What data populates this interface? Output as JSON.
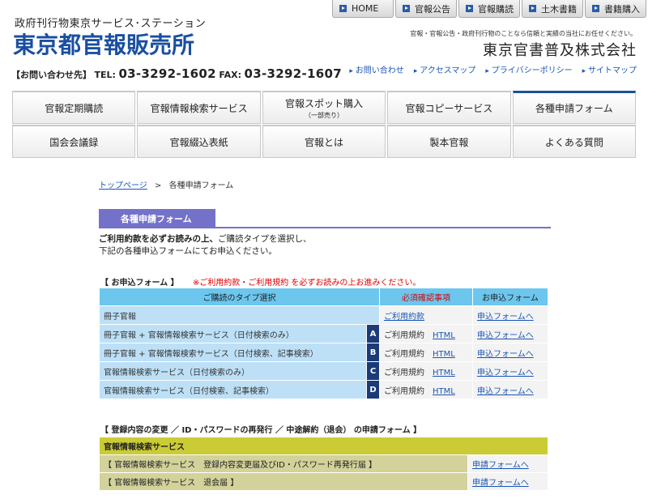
{
  "header": {
    "subtitle": "政府刊行物東京サービス･ステーション",
    "logo": "東京都官報販売所",
    "contact_label": "【お問い合わせ先】",
    "tel_label": "TEL:",
    "tel": "03-3292-1602",
    "fax_label": "FAX:",
    "fax": "03-3292-1607",
    "tagline": "官報・官報公告・政府刊行物のことなら信頼と実績の当社にお任せください。",
    "company": "東京官書普及株式会社",
    "top_nav": [
      "HOME",
      "官報公告",
      "官報購読",
      "土木書籍",
      "書籍購入"
    ],
    "util_links": [
      "お問い合わせ",
      "アクセスマップ",
      "プライバシーポリシー",
      "サイトマップ"
    ]
  },
  "nav": {
    "row1": [
      {
        "label": "官報定期購読",
        "sub": ""
      },
      {
        "label": "官報情報検索サービス",
        "sub": ""
      },
      {
        "label": "官報スポット購入",
        "sub": "（一部売り）"
      },
      {
        "label": "官報コピーサービス",
        "sub": ""
      },
      {
        "label": "各種申請フォーム",
        "sub": ""
      }
    ],
    "row2": [
      "国会会議録",
      "官報綴込表紙",
      "官報とは",
      "製本官報",
      "よくある質問"
    ],
    "active": "各種申請フォーム"
  },
  "breadcrumb": {
    "home": "トップページ",
    "sep": ">",
    "current": "各種申請フォーム"
  },
  "section": {
    "title": "各種申請フォーム",
    "intro_bold": "ご利用約款を必ずお読みの上、",
    "intro_rest": "ご購読タイプを選択し、",
    "intro_line2": "下記の各種申込フォームにてお申込ください。"
  },
  "apply_form": {
    "heading": "【 お申込フォーム 】",
    "warning": "※ご利用約款・ご利用規約 を必ずお読みの上お進みください。",
    "columns": [
      "ご購読のタイプ選択",
      "必須確認事項",
      "お申込フォーム"
    ],
    "rows": [
      {
        "type": "冊子官報",
        "letter": "",
        "conf": "ご利用約款",
        "html": "",
        "link": "申込フォームへ"
      },
      {
        "type": "冊子官報 + 官報情報検索サービス（日付検索のみ）",
        "letter": "A",
        "conf": "ご利用規約",
        "html": "HTML",
        "link": "申込フォームへ"
      },
      {
        "type": "冊子官報 + 官報情報検索サービス（日付検索、記事検索）",
        "letter": "B",
        "conf": "ご利用規約",
        "html": "HTML",
        "link": "申込フォームへ"
      },
      {
        "type": "官報情報検索サービス（日付検索のみ）",
        "letter": "C",
        "conf": "ご利用規約",
        "html": "HTML",
        "link": "申込フォームへ"
      },
      {
        "type": "官報情報検索サービス（日付検索、記事検索）",
        "letter": "D",
        "conf": "ご利用規約",
        "html": "HTML",
        "link": "申込フォームへ"
      }
    ]
  },
  "change_form": {
    "heading": "【 登録内容の変更 ／ ID・パスワードの再発行 ／ 中途解約（退会） の申請フォーム 】",
    "group": "官報情報検索サービス",
    "rows": [
      {
        "label": "【 官報情報検索サービス　登録内容変更届及びID・パスワード再発行届 】",
        "link": "申請フォームへ"
      },
      {
        "label": "【 官報情報検索サービス　退会届 】",
        "link": "申請フォームへ"
      }
    ]
  },
  "colors": {
    "accent": "#1a4fa0",
    "section": "#7472c8",
    "table_head": "#6cc6ee",
    "table_row": "#bde0f7",
    "letter": "#1a3a78",
    "olive": "#cbcc35",
    "warning": "#dd0000"
  }
}
